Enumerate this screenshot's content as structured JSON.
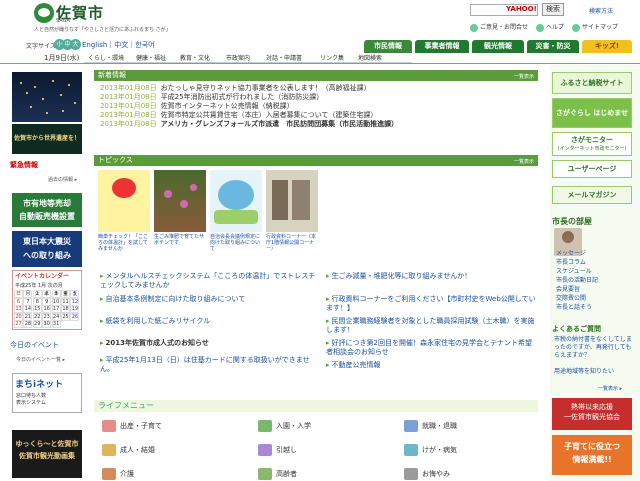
{
  "header": {
    "site_name": "佐賀市",
    "site_sub": "SAGA",
    "tagline": "人と自然が織りなす「やさしさと活力にあふれるまち さが」",
    "search_placeholder": "",
    "search_logo": "YAHOO!",
    "search_button": "検索",
    "search_help": "検索方法",
    "links": [
      "ご意見・お問合せ",
      "ヘルプ",
      "サイトマップ"
    ]
  },
  "font_size": {
    "label": "文字サイズ",
    "sizes": [
      "小",
      "中",
      "大"
    ]
  },
  "lang": "English｜中文｜한국어",
  "main_tabs": [
    {
      "label": "市民情報",
      "color": "#3a8a3a"
    },
    {
      "label": "事業者情報",
      "color": "#1f7a2e"
    },
    {
      "label": "観光情報",
      "color": "#1f7a2e"
    },
    {
      "label": "災害・防災",
      "color": "#1f7a2e"
    },
    {
      "label": "キッズ!",
      "color": "#f0c020"
    }
  ],
  "date": "1月9日(水)",
  "nav": [
    "くらし・環境",
    "健康・福祉",
    "教育・文化",
    "市政案内",
    "対話・申請書",
    "リンク集",
    "地図検索"
  ],
  "left": {
    "world_banner": "佐賀市から世界遺産を！",
    "emergency_head": "緊急情報",
    "emergency_past": "過去の情報 ▸",
    "green_banner": [
      "市有地等売却",
      "自動販売機設置"
    ],
    "disaster_banner": [
      "東日本大震災",
      "への取り組み"
    ],
    "calendar_title": "イベントカレンダー",
    "calendar_month": "平成25年 1月 次の月",
    "calendar_days": [
      "日",
      "月",
      "火",
      "水",
      "木",
      "金",
      "土",
      "1",
      "2",
      "3",
      "4",
      "5",
      "6",
      "7",
      "8",
      "9",
      "10",
      "11",
      "12",
      "13",
      "14",
      "15",
      "16",
      "17",
      "18",
      "19",
      "20",
      "21",
      "22",
      "23",
      "24",
      "25",
      "26",
      "27",
      "28",
      "29",
      "30",
      "31"
    ],
    "today_event": "今日のイベント",
    "today_sub": "今日のイベント一覧 ▸",
    "machi_title": "まちiネット",
    "machi_sub": [
      "窓口待ち人数",
      "表示システム"
    ],
    "guide_banner": [
      "ゆっくら～と佐賀市",
      "佐賀市観光動画集"
    ]
  },
  "news": {
    "title": "新着情報",
    "more": "一覧表示",
    "items": [
      {
        "date": "2013年01月08日",
        "text": "おたっしゃ見守りネット協力事業者を公表します！（高齢福祉課）"
      },
      {
        "date": "2013年01月08日",
        "text": "平成25年消防出初式が行われました（消防防災課）"
      },
      {
        "date": "2013年01月08日",
        "text": "佐賀市インターネット公売情報（納税課）"
      },
      {
        "date": "2013年01月08日",
        "text": "佐賀市特定公共賃貸住宅（本庄）入居者募集について（建築住宅課）"
      },
      {
        "date": "2013年01月08日",
        "text": "アメリカ・グレンズフォールズ市派遣　市民訪問団募集（市民活動推進課）"
      }
    ]
  },
  "topics": {
    "title": "トピックス",
    "more": "一覧表示",
    "items": [
      {
        "caption": "簡単チェック！「こころの体温計」を試してみませんか"
      },
      {
        "caption": "生ごみ堆肥で育てたサボテンです"
      },
      {
        "caption": "自治会長会議例規定に向けた取り組みについて"
      },
      {
        "caption": "行政資料コーナー（本庁1階情報公開コーナー）"
      }
    ],
    "links_left": [
      "メンタルヘルスチェックシステム「こころの体温計」でストレスチェックしてみませんか",
      "自治基本条例制定に向けた取り組みについて",
      "紙袋を利用した紙ごみリサイクル",
      "2013年佐賀市成人式のお知らせ",
      "平成25年1月13日（日）は住基カードに関する取扱いができません。"
    ],
    "links_right": [
      "生ごみ減量・堆肥化等に取り組みませんか！",
      "行政資料コーナーをご利用ください【市町村史をWeb公開しています！】",
      "民間企業職務経験者を対象とした職員採用試験（土木職）を実施します！",
      "好評につき第2回目を開催！森永家住宅の見学会とテナント希望者相談会のお知らせ",
      "不動産公売情報"
    ],
    "bold_link": "2013年佐賀市成人式のお知らせ"
  },
  "life": {
    "title": "ライフメニュー",
    "items": [
      {
        "label": "出産・子育て",
        "color": "#e78a8a"
      },
      {
        "label": "入園・入学",
        "color": "#7ab86c"
      },
      {
        "label": "就職・退職",
        "color": "#7aa0d8"
      },
      {
        "label": "成人・結婚",
        "color": "#e1b35d"
      },
      {
        "label": "引越し",
        "color": "#a88ad4"
      },
      {
        "label": "けが・病気",
        "color": "#6cb7c9"
      },
      {
        "label": "介護",
        "color": "#d48a5a"
      },
      {
        "label": "高齢者",
        "color": "#8ab86c"
      },
      {
        "label": "お悔やみ",
        "color": "#9a9a9a"
      }
    ]
  },
  "right": {
    "banner1": "ふるさと納税サイト",
    "banner2": "さがぐらし はじめませんか",
    "banner3": "さがモニター",
    "banner3_sub": "(インターネット市政モニター)",
    "banner4": "ユーザーページ",
    "banner5": "メールマガジン",
    "mayor_head": "市長の部屋",
    "mayor_links": [
      "メッセージ",
      "市長コラム",
      "スケジュール",
      "市長の活動日記",
      "会見要旨",
      "交際費公開",
      "市長と話そう"
    ],
    "faq_head": "よくあるご質問",
    "faq": [
      "市税の納付書をなくしてしまったのですが、再発行してもらえますか？",
      "用途地域等を知りたい"
    ],
    "faq_more": "一覧表示 ▸",
    "banner6": [
      "熱帯以来応援",
      "一佐賀市観光協会"
    ],
    "banner7": [
      "子育てに役立つ",
      "情報満載!!"
    ]
  }
}
